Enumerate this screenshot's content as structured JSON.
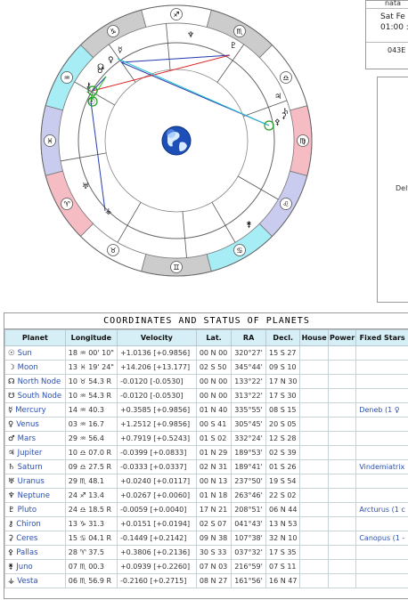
{
  "header": {
    "name_cut": "nata",
    "date_cut": "Sat Fe",
    "time_cut": "01:00 :",
    "code_cut": "043E"
  },
  "side_panel": {
    "label_cut": "Delt"
  },
  "wheel": {
    "sign_glyphs": [
      "♐",
      "♑",
      "♒",
      "♓",
      "♈",
      "♉",
      "♊",
      "♋",
      "♌",
      "♍",
      "♎",
      "♏"
    ],
    "planet_glyphs": {
      "neptune": "♆",
      "pluto": "♇",
      "jupiter": "♃",
      "saturn": "♄",
      "ceres": "⚳",
      "pallas": "⚴",
      "juno": "⚵",
      "vesta": "⚶",
      "uranus": "♅",
      "mercury": "☿",
      "venus": "♀",
      "mars": "♂",
      "moon": "☽",
      "sun": "☉",
      "node": "☊",
      "chiron": "⚷"
    },
    "center": "globe-icon"
  },
  "table": {
    "title": "COORDINATES AND STATUS OF PLANETS",
    "headers": [
      "Planet",
      "Longitude",
      "Velocity",
      "Lat.",
      "RA",
      "Decl.",
      "House",
      "Power",
      "Fixed Stars"
    ],
    "rows": [
      {
        "glyph": "☉",
        "name": "Sun",
        "lon": "18 ♒ 00' 10\"",
        "vel": "+1.0136  [+0.9856]",
        "lat": "00 N 00",
        "ra": "320°27'",
        "decl": "15 S 27",
        "house": "",
        "power": "",
        "star": ""
      },
      {
        "glyph": "☽",
        "name": "Moon",
        "lon": "13 ♓ 19' 24\"",
        "vel": "+14.206  [+13.177]",
        "lat": "02 S 50",
        "ra": "345°44'",
        "decl": "09 S 10",
        "house": "",
        "power": "",
        "star": ""
      },
      {
        "glyph": "☊",
        "name": "North Node",
        "lon": "10 ♉ 54.3  R",
        "vel": "-0.0120  [-0.0530]",
        "lat": "00 N 00",
        "ra": "133°22'",
        "decl": "17 N 30",
        "house": "",
        "power": "",
        "star": ""
      },
      {
        "glyph": "☋",
        "name": "South Node",
        "lon": "10 ♒ 54.3  R",
        "vel": "-0.0120  [-0.0530]",
        "lat": "00 N 00",
        "ra": "313°22'",
        "decl": "17 S 30",
        "house": "",
        "power": "",
        "star": ""
      },
      {
        "glyph": "☿",
        "name": "Mercury",
        "lon": "14 ♒ 40.3",
        "vel": "+0.3585  [+0.9856]",
        "lat": "01 N 40",
        "ra": "335°55'",
        "decl": "08 S 15",
        "house": "",
        "power": "",
        "star": "Deneb (1 ♀"
      },
      {
        "glyph": "♀",
        "name": "Venus",
        "lon": "03 ♒ 16.7",
        "vel": "+1.2512  [+0.9856]",
        "lat": "00 S 41",
        "ra": "305°45'",
        "decl": "20 S 05",
        "house": "",
        "power": "",
        "star": ""
      },
      {
        "glyph": "♂",
        "name": "Mars",
        "lon": "29 ♒ 56.4",
        "vel": "+0.7919  [+0.5243]",
        "lat": "01 S 02",
        "ra": "332°24'",
        "decl": "12 S 28",
        "house": "",
        "power": "",
        "star": ""
      },
      {
        "glyph": "♃",
        "name": "Jupiter",
        "lon": "10 ♎ 07.0  R",
        "vel": "-0.0399  [+0.0833]",
        "lat": "01 N 29",
        "ra": "189°53'",
        "decl": "02 S 39",
        "house": "",
        "power": "",
        "star": ""
      },
      {
        "glyph": "♄",
        "name": "Saturn",
        "lon": "09 ♎ 27.5  R",
        "vel": "-0.0333  [+0.0337]",
        "lat": "02 N 31",
        "ra": "189°41'",
        "decl": "01 S 26",
        "house": "",
        "power": "",
        "star": "Vindemiatrix"
      },
      {
        "glyph": "♅",
        "name": "Uranus",
        "lon": "29 ♏ 48.1",
        "vel": "+0.0240  [+0.0117]",
        "lat": "00 N 13",
        "ra": "237°50'",
        "decl": "19 S 54",
        "house": "",
        "power": "",
        "star": ""
      },
      {
        "glyph": "♆",
        "name": "Neptune",
        "lon": "24 ♐ 13.4",
        "vel": "+0.0267  [+0.0060]",
        "lat": "01 N 18",
        "ra": "263°46'",
        "decl": "22 S 02",
        "house": "",
        "power": "",
        "star": ""
      },
      {
        "glyph": "♇",
        "name": "Pluto",
        "lon": "24 ♎ 18.5  R",
        "vel": "-0.0059  [+0.0040]",
        "lat": "17 N 21",
        "ra": "208°51'",
        "decl": "06 N 44",
        "house": "",
        "power": "",
        "star": "Arcturus (1 c"
      },
      {
        "glyph": "⚷",
        "name": "Chiron",
        "lon": "13 ♑ 31.3",
        "vel": "+0.0151  [+0.0194]",
        "lat": "02 S 07",
        "ra": "041°43'",
        "decl": "13 N 53",
        "house": "",
        "power": "",
        "star": ""
      },
      {
        "glyph": "⚳",
        "name": "Ceres",
        "lon": "15 ♋ 04.1  R",
        "vel": "-0.1449  [+0.2142]",
        "lat": "09 N 38",
        "ra": "107°38'",
        "decl": "32 N 10",
        "house": "",
        "power": "",
        "star": "Canopus (1 -"
      },
      {
        "glyph": "⚴",
        "name": "Pallas",
        "lon": "28 ♈ 37.5",
        "vel": "+0.3806  [+0.2136]",
        "lat": "30 S 33",
        "ra": "037°32'",
        "decl": "17 S 35",
        "house": "",
        "power": "",
        "star": ""
      },
      {
        "glyph": "⚵",
        "name": "Juno",
        "lon": "07 ♏ 00.3",
        "vel": "+0.0939  [+0.2260]",
        "lat": "07 N 03",
        "ra": "216°59'",
        "decl": "07 S 11",
        "house": "",
        "power": "",
        "star": ""
      },
      {
        "glyph": "⚶",
        "name": "Vesta",
        "lon": "06 ♏ 56.9  R",
        "vel": "-0.2160  [+0.2715]",
        "lat": "08 N 27",
        "ra": "161°56'",
        "decl": "16 N 47",
        "house": "",
        "power": "",
        "star": ""
      }
    ]
  }
}
